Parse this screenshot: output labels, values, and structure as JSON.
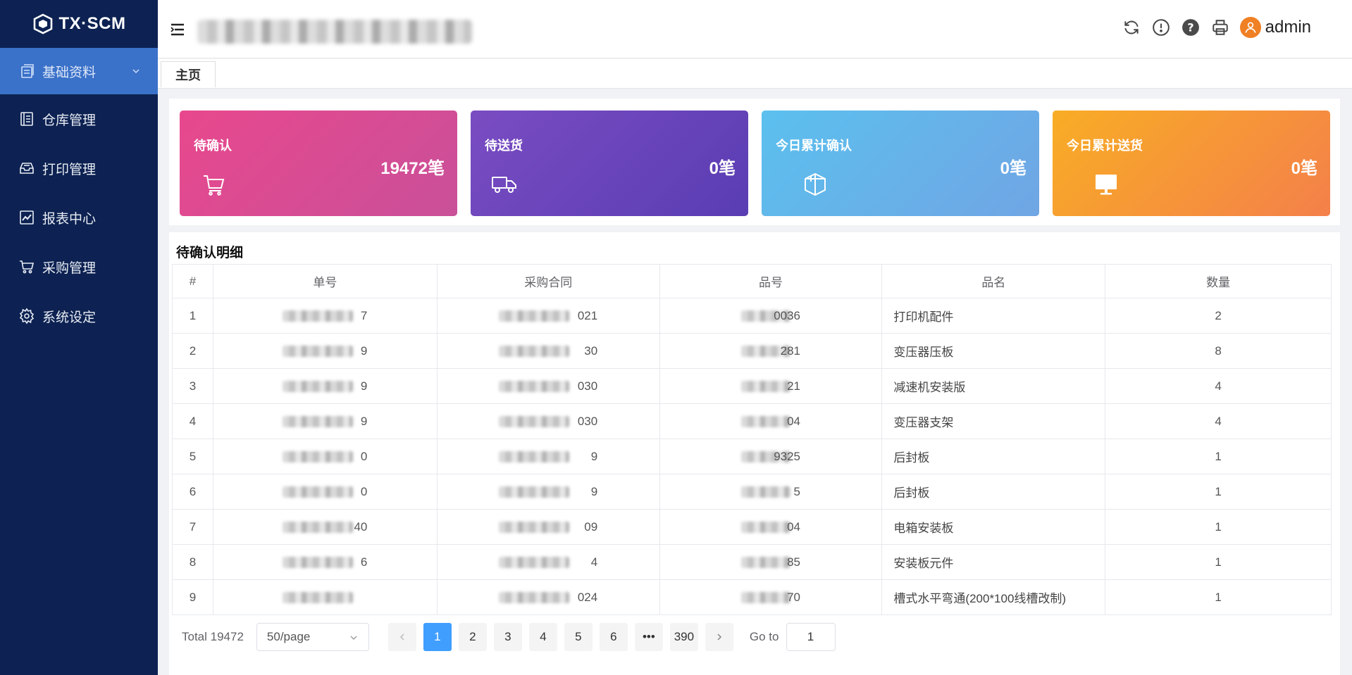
{
  "app": {
    "logo_text": "TX·SCM"
  },
  "sidebar": {
    "items": [
      {
        "label": "基础资料",
        "icon": "document-list-icon",
        "active": true
      },
      {
        "label": "仓库管理",
        "icon": "ledger-icon"
      },
      {
        "label": "打印管理",
        "icon": "inbox-tray-icon"
      },
      {
        "label": "报表中心",
        "icon": "line-chart-icon"
      },
      {
        "label": "采购管理",
        "icon": "shopping-cart-icon"
      },
      {
        "label": "系统设定",
        "icon": "gear-icon"
      }
    ]
  },
  "header": {
    "user": "admin",
    "icons": [
      "refresh-icon",
      "alert-circle-icon",
      "help-circle-icon",
      "printer-icon",
      "user-avatar-icon"
    ]
  },
  "tabs": [
    {
      "label": "主页"
    }
  ],
  "cards": [
    {
      "title": "待确认",
      "value": "19472笔",
      "icon": "cart-icon",
      "color": "#e8488d"
    },
    {
      "title": "待送货",
      "value": "0笔",
      "icon": "truck-icon",
      "color": "#6a44bb"
    },
    {
      "title": "今日累计确认",
      "value": "0笔",
      "icon": "box-icon",
      "color": "#5bc0ee"
    },
    {
      "title": "今日累计送货",
      "value": "0笔",
      "icon": "monitor-icon",
      "color": "#f8a02a"
    }
  ],
  "table": {
    "title": "待确认明细",
    "columns": [
      "#",
      "单号",
      "采购合同",
      "品号",
      "品名",
      "数量"
    ],
    "rows": [
      {
        "idx": "1",
        "order_tail": "7",
        "contract_tail": "021",
        "item_tail": "0036",
        "name": "打印机配件",
        "qty": "2"
      },
      {
        "idx": "2",
        "order_tail": "9",
        "contract_tail": "30",
        "item_tail": "281",
        "name": "变压器压板",
        "qty": "8"
      },
      {
        "idx": "3",
        "order_tail": "9",
        "contract_tail": "030",
        "item_tail": "21",
        "name": "减速机安装版",
        "qty": "4"
      },
      {
        "idx": "4",
        "order_tail": "9",
        "contract_tail": "030",
        "item_tail": "04",
        "name": "变压器支架",
        "qty": "4"
      },
      {
        "idx": "5",
        "order_tail": "0",
        "contract_tail": "9",
        "item_tail": "9325",
        "name": "后封板",
        "qty": "1"
      },
      {
        "idx": "6",
        "order_tail": "0",
        "contract_tail": "9",
        "item_tail": "5",
        "name": "后封板",
        "qty": "1"
      },
      {
        "idx": "7",
        "order_tail": "40",
        "contract_tail": "09",
        "item_tail": "04",
        "name": "电箱安装板",
        "qty": "1"
      },
      {
        "idx": "8",
        "order_tail": "6",
        "contract_tail": "4",
        "item_tail": "85",
        "name": "安装板元件",
        "qty": "1"
      },
      {
        "idx": "9",
        "order_tail": "",
        "contract_tail": "024",
        "item_tail": "70",
        "name": "槽式水平弯通(200*100线槽改制)",
        "qty": "1"
      }
    ]
  },
  "pagination": {
    "total_label": "Total 19472",
    "page_size": "50/page",
    "pages": [
      "1",
      "2",
      "3",
      "4",
      "5",
      "6",
      "•••",
      "390"
    ],
    "current": "1",
    "goto_label": "Go to",
    "goto_value": "1"
  }
}
